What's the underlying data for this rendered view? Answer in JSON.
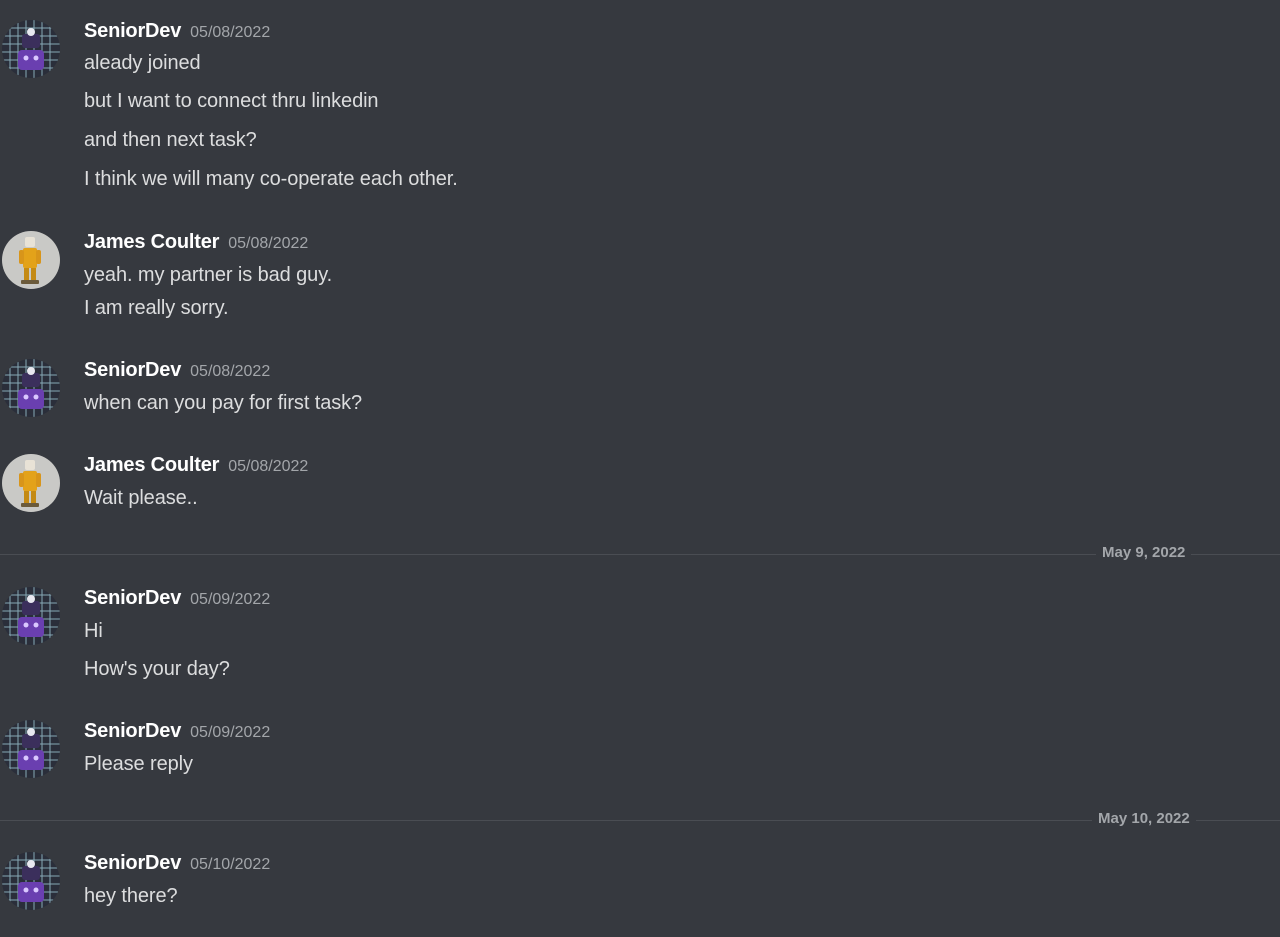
{
  "users": {
    "senior": {
      "name": "SeniorDev",
      "avatar_icon": "robot-avatar-icon"
    },
    "james": {
      "name": "James Coulter",
      "avatar_icon": "figurine-avatar-icon"
    }
  },
  "groups": [
    {
      "author": "SeniorDev",
      "timestamp": "05/08/2022",
      "messages": [
        "aleady joined",
        "but I want to connect thru linkedin",
        "and then next task?",
        "I think we will many co-operate each other."
      ]
    },
    {
      "author": "James Coulter",
      "timestamp": "05/08/2022",
      "messages": [
        "yeah. my partner is bad guy.",
        "I am really sorry."
      ]
    },
    {
      "author": "SeniorDev",
      "timestamp": "05/08/2022",
      "messages": [
        "when can you pay for first task?"
      ]
    },
    {
      "author": "James Coulter",
      "timestamp": "05/08/2022",
      "messages": [
        "Wait please.."
      ]
    },
    {
      "author": "SeniorDev",
      "timestamp": "05/09/2022",
      "messages": [
        "Hi",
        "How's your day?"
      ]
    },
    {
      "author": "SeniorDev",
      "timestamp": "05/09/2022",
      "messages": [
        "Please reply"
      ]
    },
    {
      "author": "SeniorDev",
      "timestamp": "05/10/2022",
      "messages": [
        "hey there?"
      ]
    }
  ],
  "dividers": [
    "May 9, 2022",
    "May 10, 2022"
  ],
  "colors": {
    "background": "#36393f",
    "username": "#ffffff",
    "message_text": "#dcddde",
    "timestamp": "#a3a6aa",
    "divider_line": "#4a4d53"
  }
}
